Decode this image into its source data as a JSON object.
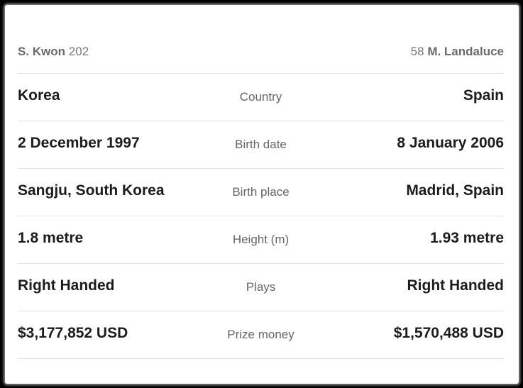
{
  "players": {
    "left": {
      "name": "S. Kwon",
      "rank": "202"
    },
    "right": {
      "name": "M. Landaluce",
      "rank": "58"
    }
  },
  "rows": [
    {
      "label": "Country",
      "left": "Korea",
      "right": "Spain"
    },
    {
      "label": "Birth date",
      "left": "2 December 1997",
      "right": "8 January 2006"
    },
    {
      "label": "Birth place",
      "left": "Sangju, South Korea",
      "right": "Madrid, Spain"
    },
    {
      "label": "Height (m)",
      "left": "1.8 metre",
      "right": "1.93 metre"
    },
    {
      "label": "Plays",
      "left": "Right Handed",
      "right": "Right Handed"
    },
    {
      "label": "Prize money",
      "left": "$3,177,852 USD",
      "right": "$1,570,488 USD"
    }
  ]
}
